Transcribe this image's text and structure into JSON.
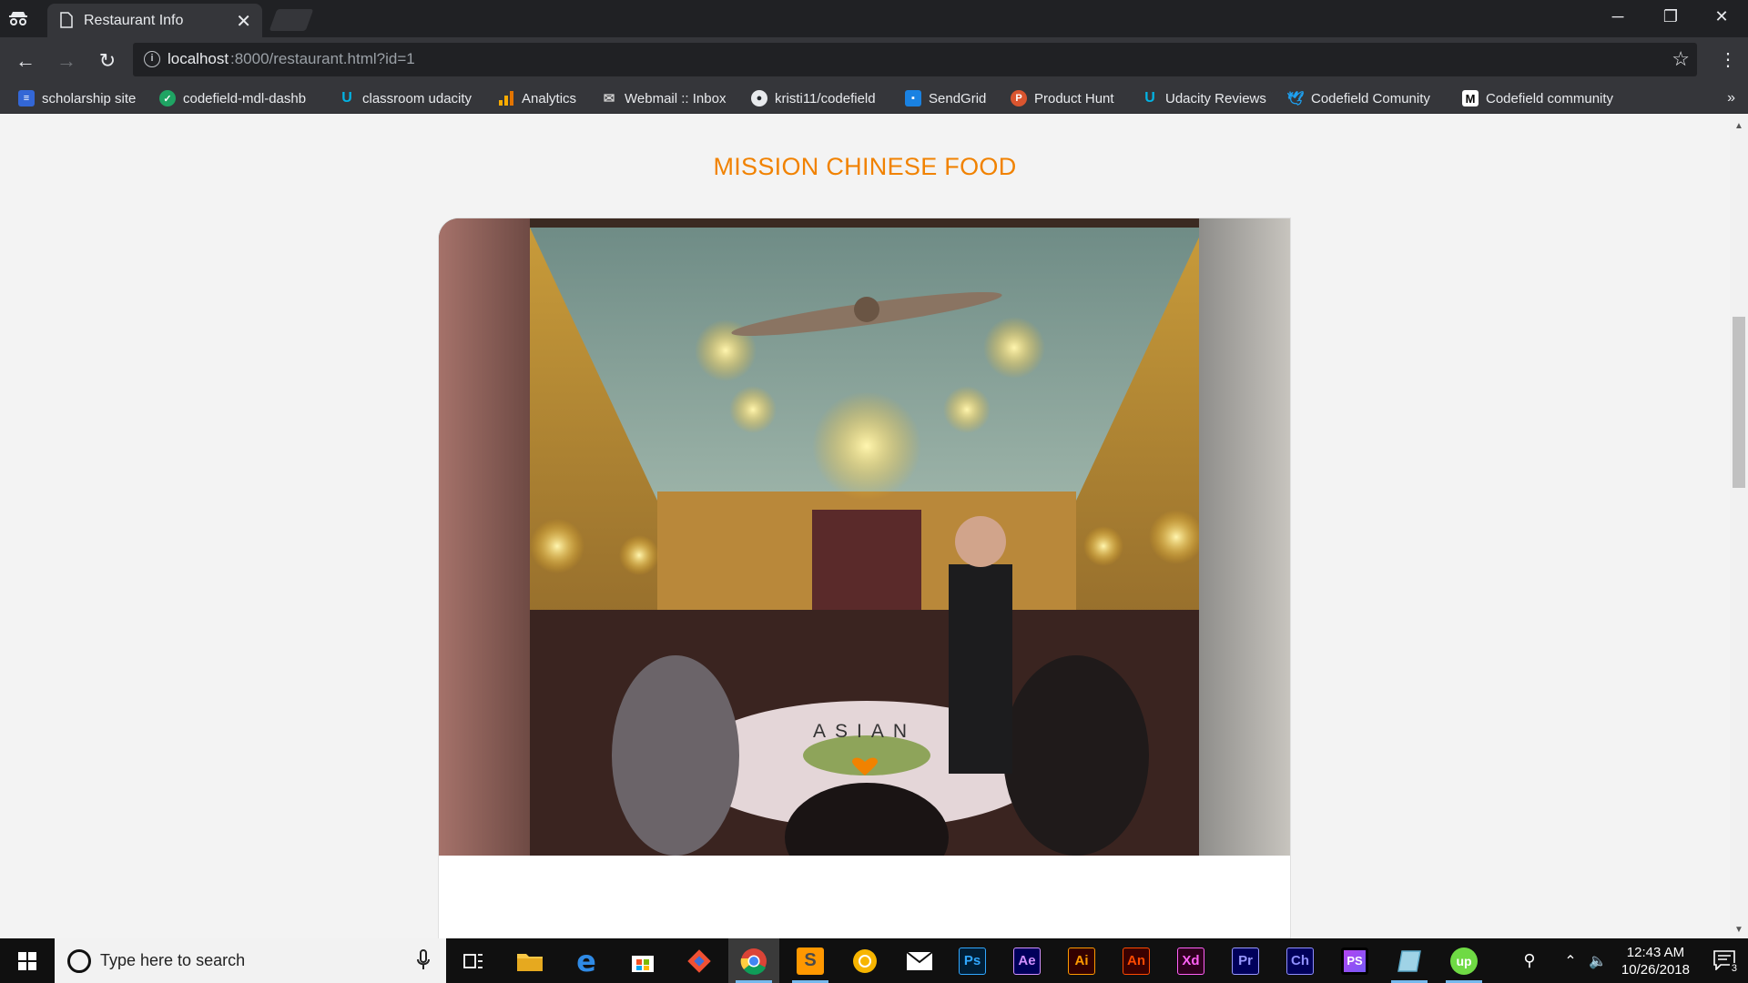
{
  "browser": {
    "tab_title": "Restaurant Info",
    "url_host": "localhost",
    "url_rest": ":8000/restaurant.html?id=1",
    "bookmarks": [
      {
        "label": "scholarship site",
        "icon": "google-forms-icon",
        "color": "#3367d6"
      },
      {
        "label": "codefield-mdl-dashb",
        "icon": "codefield-icon",
        "color": "#1fa463"
      },
      {
        "label": "classroom udacity",
        "icon": "udacity-icon",
        "color": "#02b3e4"
      },
      {
        "label": "Analytics",
        "icon": "analytics-icon",
        "color": "#f9ab00"
      },
      {
        "label": "Webmail :: Inbox",
        "icon": "mail-icon",
        "color": "#cccccc"
      },
      {
        "label": "kristi11/codefield",
        "icon": "github-icon",
        "color": "#ffffff"
      },
      {
        "label": "SendGrid",
        "icon": "sendgrid-icon",
        "color": "#1a82e2"
      },
      {
        "label": "Product Hunt",
        "icon": "producthunt-icon",
        "color": "#da552f"
      },
      {
        "label": "Udacity Reviews",
        "icon": "udacity-icon",
        "color": "#02b3e4"
      },
      {
        "label": "Codefield Comunity",
        "icon": "twitter-icon",
        "color": "#1da1f2"
      },
      {
        "label": "Codefield community",
        "icon": "medium-icon",
        "color": "#ffffff"
      }
    ]
  },
  "page": {
    "restaurant_name": "MISSION CHINESE FOOD",
    "cuisine": "ASIAN",
    "accent_color": "#f18200"
  },
  "taskbar": {
    "search_placeholder": "Type here to search",
    "time": "12:43 AM",
    "date": "10/26/2018",
    "notification_count": "3",
    "apps": [
      {
        "name": "task-view-icon",
        "label": ""
      },
      {
        "name": "file-explorer-icon",
        "label": ""
      },
      {
        "name": "edge-icon",
        "label": "e"
      },
      {
        "name": "store-icon",
        "label": ""
      },
      {
        "name": "git-icon",
        "label": ""
      },
      {
        "name": "chrome-icon",
        "label": ""
      },
      {
        "name": "sublime-icon",
        "label": "S"
      },
      {
        "name": "sketch-icon",
        "label": ""
      },
      {
        "name": "mail-app-icon",
        "label": ""
      },
      {
        "name": "photoshop-icon",
        "label": "Ps"
      },
      {
        "name": "after-effects-icon",
        "label": "Ae"
      },
      {
        "name": "illustrator-icon",
        "label": "Ai"
      },
      {
        "name": "animate-icon",
        "label": "An"
      },
      {
        "name": "xd-icon",
        "label": "Xd"
      },
      {
        "name": "premiere-icon",
        "label": "Pr"
      },
      {
        "name": "character-animator-icon",
        "label": "Ch"
      },
      {
        "name": "phpstorm-icon",
        "label": "PS"
      },
      {
        "name": "notepad-icon",
        "label": ""
      },
      {
        "name": "upwork-icon",
        "label": "up"
      }
    ]
  }
}
